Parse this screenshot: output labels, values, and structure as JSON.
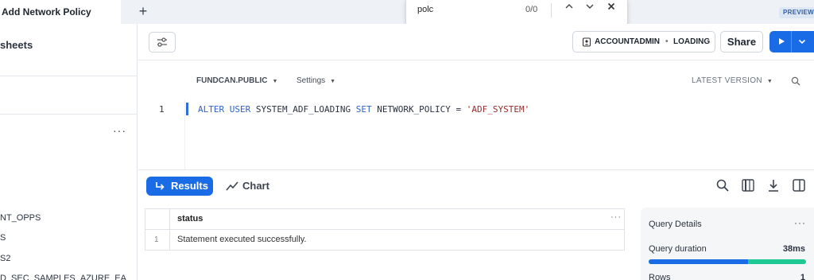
{
  "tabs": {
    "active_label": "Add Network Policy",
    "new_tab_symbol": "+"
  },
  "preview_badge": "PREVIEW",
  "find": {
    "query": "polc",
    "count": "0/0"
  },
  "sidebar": {
    "section_title": "sheets",
    "more": "···",
    "items": [
      {
        "label": "NT_OPPS"
      },
      {
        "label": "S"
      },
      {
        "label": "S2"
      },
      {
        "label": "D_SEC_SAMPLES_AZURE_EA"
      }
    ]
  },
  "toolbar": {
    "role": "ACCOUNTADMIN",
    "warehouse": "LOADING",
    "share_label": "Share"
  },
  "editor": {
    "context": "FUNDCAN.PUBLIC",
    "settings_label": "Settings",
    "version_label": "LATEST VERSION",
    "line_number": "1",
    "code": {
      "kw1": "ALTER USER",
      "ident1": "SYSTEM_ADF_LOADING",
      "kw2": "SET",
      "ident2": "NETWORK_POLICY =",
      "str": "'ADF_SYSTEM'"
    }
  },
  "results": {
    "results_tab": "Results",
    "chart_tab": "Chart",
    "columns": [
      "status"
    ],
    "rows": [
      {
        "num": "1",
        "status": "Statement executed successfully."
      }
    ],
    "column_more": "···"
  },
  "query_details": {
    "title": "Query Details",
    "more": "···",
    "duration_label": "Query duration",
    "duration_value": "38ms",
    "duration_fraction": 0.63,
    "rows_label": "Rows",
    "rows_value": "1"
  },
  "colors": {
    "accent": "#1a6ce6",
    "success": "#1fc993"
  }
}
